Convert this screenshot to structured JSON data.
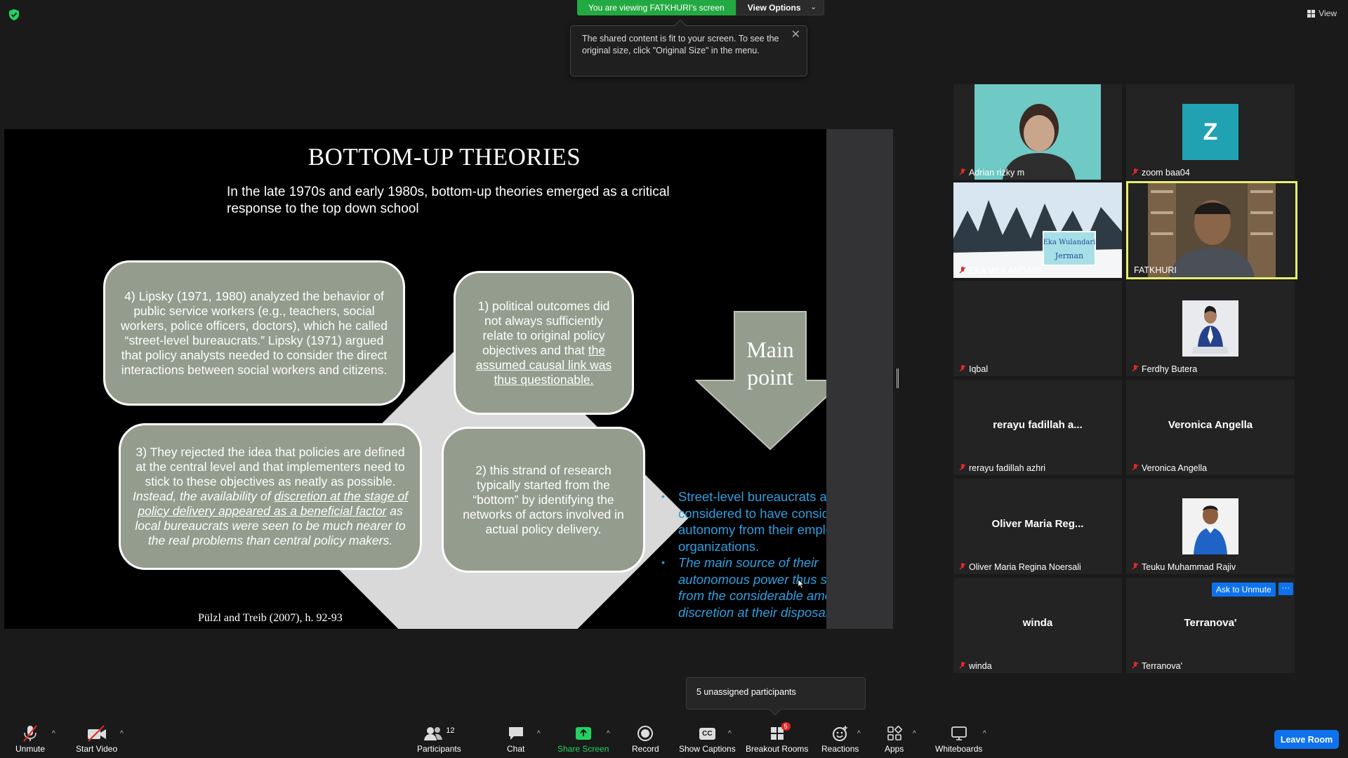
{
  "top": {
    "viewing_banner": "You are viewing FATKHURI's screen",
    "view_options": "View Options",
    "view_button": "View"
  },
  "tooltip": {
    "text": "The shared content is fit to your screen. To see the original size, click \"Original Size\" in the menu."
  },
  "slide": {
    "title": "BOTTOM-UP THEORIES",
    "subtitle": "In the late 1970s and early 1980s, bottom-up theories emerged as a critical response to the top down school",
    "box4": "4) Lipsky (1971, 1980) analyzed the behavior of public service workers (e.g., teachers, social workers, police officers, doctors), which he called “street-level bureaucrats.” Lipsky (1971) argued that policy analysts needed to consider the direct interactions between social workers and citizens.",
    "box1_a": "1) political outcomes did not always sufficiently relate to original policy objectives and that ",
    "box1_b": "the assumed causal link was thus questionable.",
    "box3_a": "3) They rejected the idea that policies are defined at the central level and that implementers need to stick to these objectives as neatly as possible. ",
    "box3_b": "Instead, the availability of ",
    "box3_c": "discretion at the stage of policy delivery appeared as a beneficial factor",
    "box3_d": " as local bureaucrats were seen to be much nearer to the real problems than central policy makers.",
    "box2": "2) this strand of research typically started from the “bottom” by identifying the networks of actors involved in actual policy delivery.",
    "arrow_text_1": "Main",
    "arrow_text_2": "point",
    "bullet1": "Street-level bureaucrats are considered to have considerable autonomy from their employing organizations.",
    "bullet2": "The main source of their autonomous power thus stems from the considerable amount of discretion at their disposal.",
    "citation": "Pülzl and Treib (2007), h. 92-93"
  },
  "participants": [
    {
      "name": "Adrian rizky m",
      "video": "photo"
    },
    {
      "name": "zoom baa04",
      "avatar_letter": "Z",
      "avatar_color": "#21a2b3"
    },
    {
      "name": "EKA WULANDARI",
      "video": "photo",
      "sign_text_1": "Eka Wulandari",
      "sign_text_2": "Jerman"
    },
    {
      "name": "FATKHURI",
      "video": "photo",
      "active_speaker": true
    },
    {
      "name": "Iqbal"
    },
    {
      "name": "Ferdhy Butera",
      "video": "photo"
    },
    {
      "name": "rerayu fadillah azhri",
      "display": "rerayu fadillah a..."
    },
    {
      "name": "Veronica Angella",
      "display": "Veronica Angella"
    },
    {
      "name": "Oliver Maria Regina Noersali",
      "display": "Oliver Maria Reg..."
    },
    {
      "name": "Teuku Muhammad Rajiv",
      "video": "photo"
    },
    {
      "name": "winda",
      "display": "winda"
    },
    {
      "name": "Terranova'",
      "display": "Terranova'"
    }
  ],
  "ask_to_unmute": "Ask to Unmute",
  "more": "···",
  "unassigned": "5 unassigned participants",
  "toolbar": {
    "unmute": "Unmute",
    "start_video": "Start Video",
    "participants": "Participants",
    "participants_count": "12",
    "chat": "Chat",
    "share_screen": "Share Screen",
    "record": "Record",
    "show_captions": "Show Captions",
    "cc": "CC",
    "breakout_rooms": "Breakout Rooms",
    "breakout_badge": "5",
    "reactions": "Reactions",
    "apps": "Apps",
    "whiteboards": "Whiteboards",
    "leave_room": "Leave Room"
  },
  "colors": {
    "accent_blue": "#0e72ed",
    "share_green": "#23a942",
    "active_speaker": "#e8ef6c",
    "slide_box": "#949c8e",
    "bullet_blue": "#2e9fe0"
  }
}
